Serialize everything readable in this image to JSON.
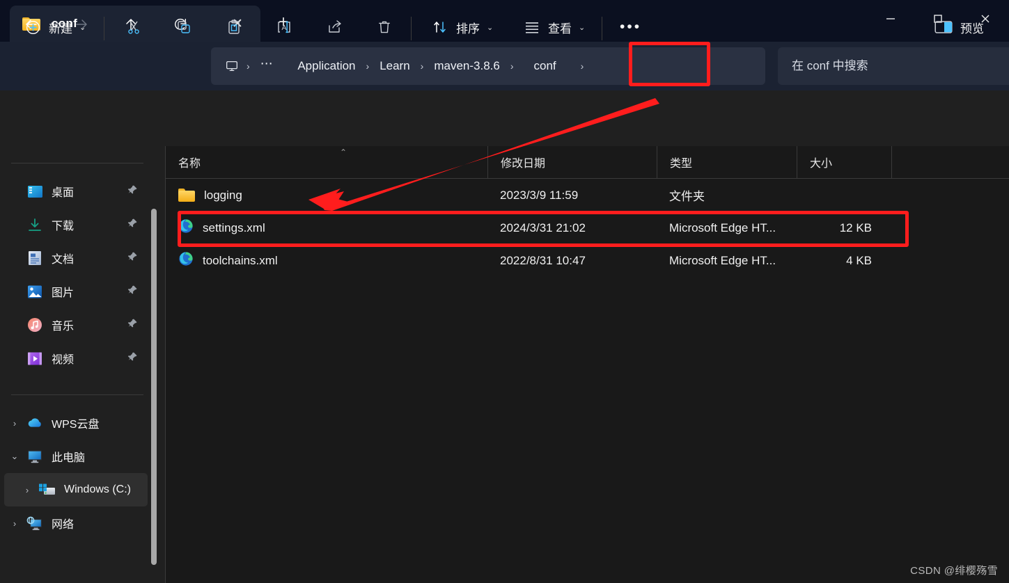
{
  "window": {
    "tab": {
      "title": "conf",
      "icon": "folder-icon",
      "close_label": "✕",
      "new_tab_label": "+"
    },
    "controls": {
      "minimize": "minimize-icon",
      "maximize": "maximize-icon",
      "close": "close-icon"
    }
  },
  "navbar": {
    "back": "back-arrow-icon",
    "forward": "forward-arrow-icon",
    "up": "up-arrow-icon",
    "refresh": "refresh-icon",
    "breadcrumb": {
      "root_icon": "this-pc-icon",
      "ellipsis": "⋯",
      "separator": "›",
      "items": [
        "Application",
        "Learn",
        "maven-3.8.6",
        "conf"
      ]
    },
    "search": {
      "placeholder": "在 conf 中搜索",
      "value": ""
    }
  },
  "commandbar": {
    "new_label": "新建",
    "new_chevron": "⌄",
    "cut": "cut-icon",
    "copy": "copy-icon",
    "paste": "paste-icon",
    "rename": "rename-icon",
    "share": "share-icon",
    "delete": "delete-icon",
    "sort_label": "排序",
    "sort_chevron": "⌄",
    "view_label": "查看",
    "view_chevron": "⌄",
    "more_label": "•••",
    "preview_label": "预览"
  },
  "sidebar": {
    "quick_access": [
      {
        "label": "桌面",
        "icon": "desktop-icon",
        "pinned": true
      },
      {
        "label": "下载",
        "icon": "downloads-icon",
        "pinned": true
      },
      {
        "label": "文档",
        "icon": "documents-icon",
        "pinned": true
      },
      {
        "label": "图片",
        "icon": "pictures-icon",
        "pinned": true
      },
      {
        "label": "音乐",
        "icon": "music-icon",
        "pinned": true
      },
      {
        "label": "视频",
        "icon": "videos-icon",
        "pinned": true
      }
    ],
    "tree": [
      {
        "label": "WPS云盘",
        "icon": "wps-cloud-icon",
        "chevron": "›",
        "expanded": false,
        "selected": false
      },
      {
        "label": "此电脑",
        "icon": "this-pc-icon",
        "chevron": "⌄",
        "expanded": true,
        "selected": false
      },
      {
        "label": "Windows (C:)",
        "icon": "drive-windows-icon",
        "chevron": "›",
        "expanded": false,
        "selected": true
      },
      {
        "label": "网络",
        "icon": "network-icon",
        "chevron": "›",
        "expanded": false,
        "selected": false
      }
    ]
  },
  "filelist": {
    "columns": [
      {
        "label": "名称",
        "sorted": true,
        "sort_caret": "⌃"
      },
      {
        "label": "修改日期"
      },
      {
        "label": "类型"
      },
      {
        "label": "大小"
      }
    ],
    "rows": [
      {
        "name": "logging",
        "icon": "folder-icon",
        "date": "2023/3/9 11:59",
        "type": "文件夹",
        "size": "",
        "highlighted": false
      },
      {
        "name": "settings.xml",
        "icon": "edge-html-icon",
        "date": "2024/3/31 21:02",
        "type": "Microsoft Edge HT...",
        "size": "12 KB",
        "highlighted": true
      },
      {
        "name": "toolchains.xml",
        "icon": "edge-html-icon",
        "date": "2022/8/31 10:47",
        "type": "Microsoft Edge HT...",
        "size": "4 KB",
        "highlighted": false
      }
    ]
  },
  "annotations": {
    "color": "#ff1d1d",
    "boxes": [
      {
        "name": "conf-breadcrumb-highlight"
      },
      {
        "name": "settings-xml-row-highlight"
      }
    ],
    "arrow": {
      "name": "pointer-arrow",
      "from": "conf breadcrumb",
      "to": "file list"
    }
  },
  "watermark": {
    "text": "CSDN @绯樱殇雪"
  }
}
